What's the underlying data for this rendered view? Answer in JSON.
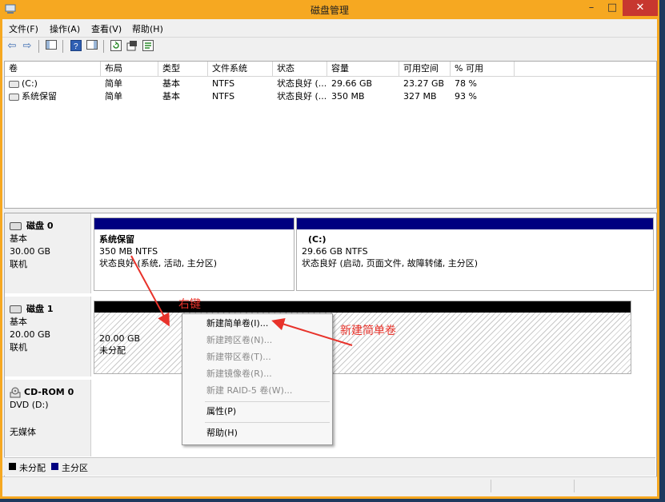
{
  "window": {
    "title": "磁盘管理",
    "minimize": "–",
    "maximize": "□",
    "close": "✕"
  },
  "menu": [
    "文件(F)",
    "操作(A)",
    "查看(V)",
    "帮助(H)"
  ],
  "toolbar_icons": [
    "back-icon",
    "forward-icon",
    "console-tree-icon",
    "help-icon",
    "properties-icon",
    "refresh-icon",
    "settings-icon",
    "export-icon"
  ],
  "volume_list": {
    "columns": [
      "卷",
      "布局",
      "类型",
      "文件系统",
      "状态",
      "容量",
      "可用空间",
      "% 可用"
    ],
    "rows": [
      [
        "(C:)",
        "简单",
        "基本",
        "NTFS",
        "状态良好 (...",
        "29.66 GB",
        "23.27 GB",
        "78 %"
      ],
      [
        "系统保留",
        "简单",
        "基本",
        "NTFS",
        "状态良好 (...",
        "350 MB",
        "327 MB",
        "93 %"
      ]
    ]
  },
  "disks": [
    {
      "name": "磁盘 0",
      "type": "基本",
      "size": "30.00 GB",
      "status": "联机",
      "partitions": [
        {
          "name": "系统保留",
          "size_fs": "350 MB NTFS",
          "status": "状态良好 (系统, 活动, 主分区)"
        },
        {
          "name": "(C:)",
          "size_fs": "29.66 GB NTFS",
          "status": "状态良好 (启动, 页面文件, 故障转储, 主分区)"
        }
      ]
    },
    {
      "name": "磁盘 1",
      "type": "基本",
      "size": "20.00 GB",
      "status": "联机",
      "partitions": [
        {
          "size": "20.00 GB",
          "status": "未分配"
        }
      ]
    },
    {
      "name": "CD-ROM 0",
      "type": "DVD (D:)",
      "status": "无媒体"
    }
  ],
  "legend": [
    {
      "label": "未分配",
      "color": "#000000"
    },
    {
      "label": "主分区",
      "color": "#000080"
    }
  ],
  "context_menu": {
    "items": [
      {
        "label": "新建简单卷(I)...",
        "enabled": true
      },
      {
        "label": "新建跨区卷(N)...",
        "enabled": false
      },
      {
        "label": "新建带区卷(T)...",
        "enabled": false
      },
      {
        "label": "新建镜像卷(R)...",
        "enabled": false
      },
      {
        "label": "新建 RAID-5 卷(W)...",
        "enabled": false
      },
      {
        "label": "属性(P)",
        "enabled": true
      },
      {
        "label": "帮助(H)",
        "enabled": true
      }
    ]
  },
  "annotations": {
    "right_click": "右键",
    "new_simple_volume": "新建简单卷"
  },
  "colors": {
    "title_bar": "#f6a821",
    "close_button": "#c7372f",
    "primary_partition": "#000080",
    "annotation": "#e8322a"
  }
}
